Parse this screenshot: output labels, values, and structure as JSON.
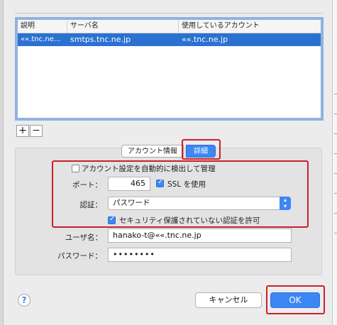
{
  "table": {
    "columns": [
      "説明",
      "サーバ名",
      "使用しているアカウント"
    ],
    "rows": [
      {
        "description": "««.tnc.ne...",
        "server": "smtps.tnc.ne.jp",
        "account": "««.tnc.ne.jp"
      }
    ]
  },
  "toolbar": {
    "add_label": "+",
    "remove_label": "−"
  },
  "tabs": {
    "account_info": "アカウント情報",
    "details": "詳細"
  },
  "details": {
    "auto_detect_label": "アカウント設定を自動的に検出して管理",
    "auto_detect_checked": false,
    "port_label": "ポート：",
    "port_value": "465",
    "ssl_label": "SSL を使用",
    "ssl_checked": true,
    "auth_label": "認証：",
    "auth_value": "パスワード",
    "insecure_auth_label": "セキュリティ保護されていない認証を許可",
    "insecure_auth_checked": true
  },
  "credentials": {
    "username_label": "ユーザ名：",
    "username_value": "hanako-t@««.tnc.ne.jp",
    "password_label": "パスワード：",
    "password_value": "••••••••"
  },
  "footer": {
    "help_label": "?",
    "cancel_label": "キャンセル",
    "ok_label": "OK"
  },
  "colors": {
    "accent": "#3d86f5",
    "selection": "#2b71d1",
    "highlight_box": "#c8202b"
  }
}
